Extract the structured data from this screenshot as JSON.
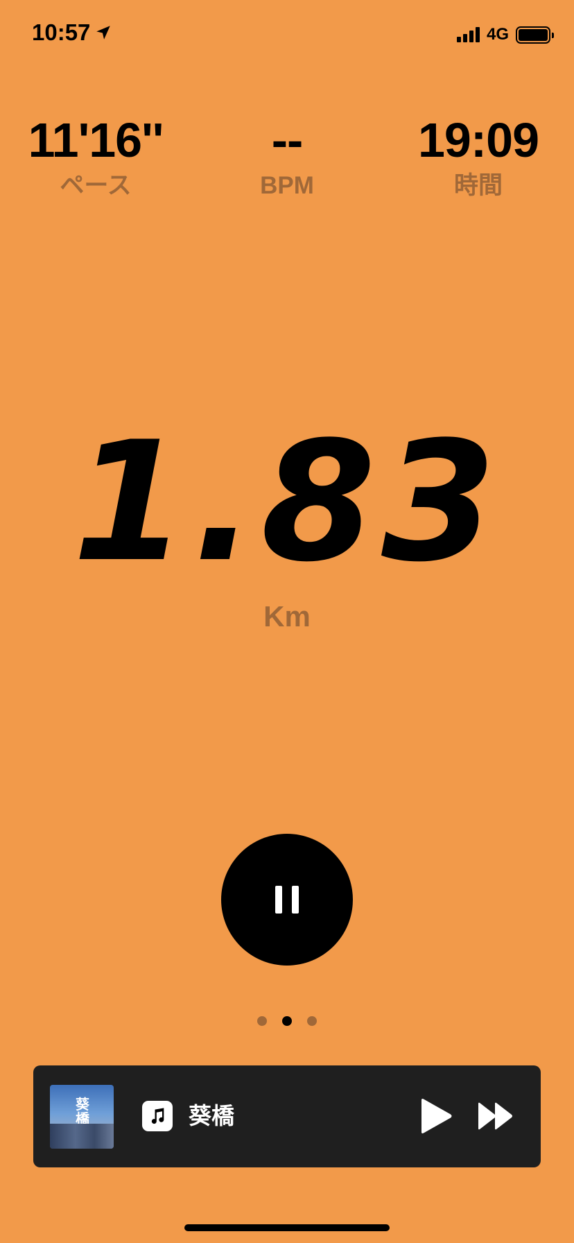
{
  "status_bar": {
    "time": "10:57",
    "network": "4G"
  },
  "stats": {
    "pace": {
      "value": "11'16''",
      "label": "ペース"
    },
    "heart_rate": {
      "value": "--",
      "label": "BPM"
    },
    "duration": {
      "value": "19:09",
      "label": "時間"
    }
  },
  "distance": {
    "value": "1.83",
    "unit": "Km"
  },
  "pager": {
    "page_count": 3,
    "active_index": 1
  },
  "now_playing": {
    "track_title": "葵橋",
    "album_art_title": "葵橋"
  },
  "colors": {
    "background": "#F29A4A",
    "secondary_text": "#A06838",
    "music_bar": "#1F1F1F"
  }
}
